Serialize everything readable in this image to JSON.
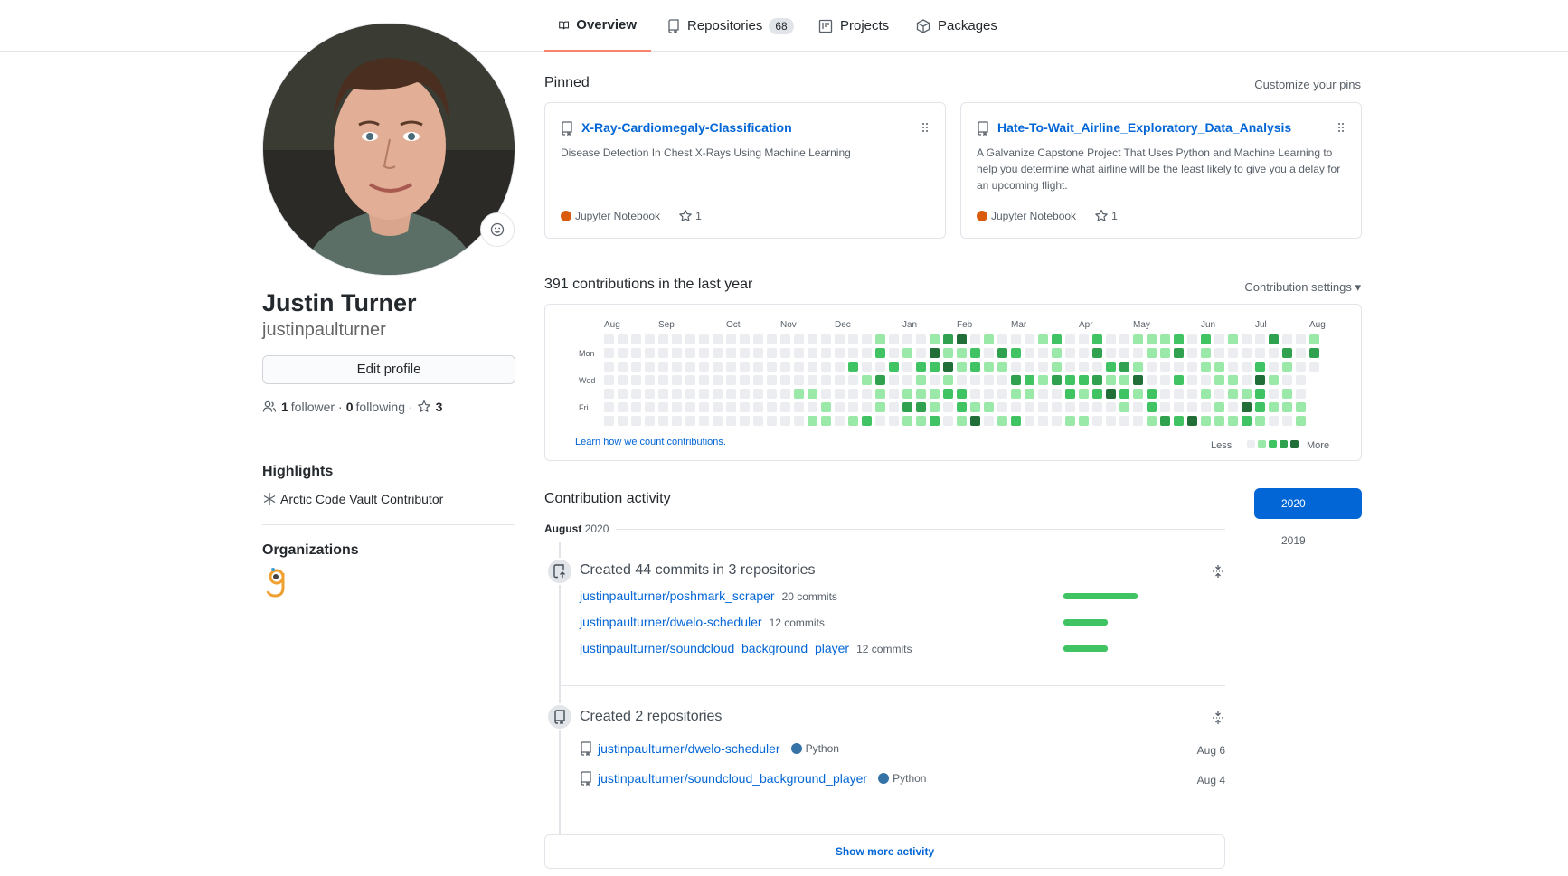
{
  "nav": {
    "tabs": [
      {
        "label": "Overview",
        "icon": "book-icon"
      },
      {
        "label": "Repositories",
        "icon": "repo-icon",
        "count": "68"
      },
      {
        "label": "Projects",
        "icon": "project-icon"
      },
      {
        "label": "Packages",
        "icon": "package-icon"
      }
    ]
  },
  "profile": {
    "full_name": "Justin Turner",
    "username": "justinpaulturner",
    "edit_label": "Edit profile",
    "followers_count": "1",
    "followers_label": "follower",
    "dot": "·",
    "following_count": "0",
    "following_label": "following",
    "stars_count": "3",
    "highlights_title": "Highlights",
    "highlight_item": "Arctic Code Vault Contributor",
    "organizations_title": "Organizations"
  },
  "pinned": {
    "title": "Pinned",
    "customize_label": "Customize your pins",
    "cards": [
      {
        "name": "X-Ray-Cardiomegaly-Classification",
        "description": "Disease Detection In Chest X-Rays Using Machine Learning",
        "language": "Jupyter Notebook",
        "language_color": "#DA5B0B",
        "stars": "1"
      },
      {
        "name": "Hate-To-Wait_Airline_Exploratory_Data_Analysis",
        "description": "A Galvanize Capstone Project That Uses Python and Machine Learning to help you determine what airline will be the least likely to give you a delay for an upcoming flight.",
        "language": "Jupyter Notebook",
        "language_color": "#DA5B0B",
        "stars": "1"
      }
    ]
  },
  "contributions": {
    "title": "391 contributions in the last year",
    "settings_label": "Contribution settings ▾",
    "months": [
      "Aug",
      "Sep",
      "Oct",
      "Nov",
      "Dec",
      "Jan",
      "Feb",
      "Mar",
      "Apr",
      "May",
      "Jun",
      "Jul",
      "Aug"
    ],
    "days": [
      "Mon",
      "Wed",
      "Fri"
    ],
    "learn_label": "Learn how we count contributions.",
    "less_label": "Less",
    "more_label": "More",
    "colors": [
      "#ebedf0",
      "#9be9a8",
      "#40c463",
      "#30a14e",
      "#216e39"
    ]
  },
  "activity": {
    "title": "Contribution activity",
    "month": "August",
    "year": "2020",
    "commits_header": "Created 44 commits in 3 repositories",
    "commits": [
      {
        "repo": "justinpaulturner/poshmark_scraper",
        "count": "20 commits",
        "fraction": 1.0
      },
      {
        "repo": "justinpaulturner/dwelo-scheduler",
        "count": "12 commits",
        "fraction": 0.6
      },
      {
        "repo": "justinpaulturner/soundcloud_background_player",
        "count": "12 commits",
        "fraction": 0.6
      }
    ],
    "repos_header": "Created 2 repositories",
    "repos": [
      {
        "repo": "justinpaulturner/dwelo-scheduler",
        "language": "Python",
        "language_color": "#3572A5",
        "date": "Aug 6"
      },
      {
        "repo": "justinpaulturner/soundcloud_background_player",
        "language": "Python",
        "language_color": "#3572A5",
        "date": "Aug 4"
      }
    ],
    "show_more_label": "Show more activity"
  },
  "years": [
    "2020",
    "2019"
  ]
}
